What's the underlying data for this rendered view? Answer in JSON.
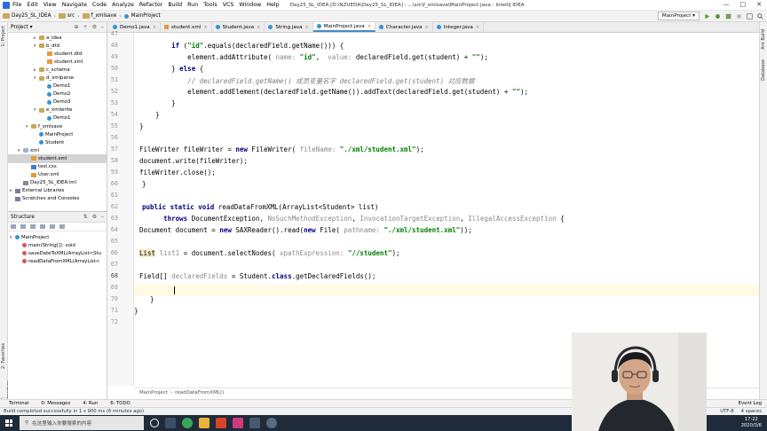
{
  "titlebar": {
    "menu": [
      "File",
      "Edit",
      "View",
      "Navigate",
      "Code",
      "Analyze",
      "Refactor",
      "Build",
      "Run",
      "Tools",
      "VCS",
      "Window",
      "Help"
    ],
    "title": "Day25_SL_IDEA [D:\\NZUEDA\\Day25_SL_IDEA] - ...\\src\\f_xmlsave\\MainProject.java - IntelliJ IDEA"
  },
  "navbar": {
    "crumbs": [
      "Day25_SL_IDEA",
      "src",
      "f_xmlsave",
      "MainProject"
    ],
    "run_config": "MainProject"
  },
  "project_panel": {
    "header": "Project",
    "tree": [
      {
        "label": "a_idea",
        "indent": 3,
        "icon": "dir",
        "arrow": "▸"
      },
      {
        "label": "b_dtd",
        "indent": 3,
        "icon": "dir",
        "arrow": "▾"
      },
      {
        "label": "student.dtd",
        "indent": 4,
        "icon": "xml",
        "arrow": ""
      },
      {
        "label": "student.xml",
        "indent": 4,
        "icon": "xml",
        "arrow": ""
      },
      {
        "label": "c_schema",
        "indent": 3,
        "icon": "dir",
        "arrow": "▸"
      },
      {
        "label": "d_xmlparse",
        "indent": 3,
        "icon": "dir",
        "arrow": "▾"
      },
      {
        "label": "Demo1",
        "indent": 4,
        "icon": "class",
        "arrow": ""
      },
      {
        "label": "Demo2",
        "indent": 4,
        "icon": "class",
        "arrow": ""
      },
      {
        "label": "Demo3",
        "indent": 4,
        "icon": "class",
        "arrow": ""
      },
      {
        "label": "e_xmlwrite",
        "indent": 3,
        "icon": "dir",
        "arrow": "▾"
      },
      {
        "label": "Demo1",
        "indent": 4,
        "icon": "class",
        "arrow": ""
      },
      {
        "label": "f_xmlsave",
        "indent": 2,
        "icon": "dir",
        "arrow": "▾"
      },
      {
        "label": "MainProject",
        "indent": 3,
        "icon": "class",
        "arrow": ""
      },
      {
        "label": "Student",
        "indent": 3,
        "icon": "class",
        "arrow": ""
      },
      {
        "label": "xml",
        "indent": 1,
        "icon": "folder",
        "arrow": "▾"
      },
      {
        "label": "student.xml",
        "indent": 2,
        "icon": "xml",
        "arrow": "",
        "selected": true
      },
      {
        "label": "test.css",
        "indent": 2,
        "icon": "css",
        "arrow": ""
      },
      {
        "label": "User.xml",
        "indent": 2,
        "icon": "xml",
        "arrow": ""
      },
      {
        "label": "Day25_SL_IDEA.iml",
        "indent": 1,
        "icon": "iml",
        "arrow": ""
      },
      {
        "label": "External Libraries",
        "indent": 0,
        "icon": "lib",
        "arrow": "▸"
      },
      {
        "label": "Scratches and Consoles",
        "indent": 0,
        "icon": "lib",
        "arrow": ""
      }
    ]
  },
  "structure_panel": {
    "header": "Structure",
    "items": [
      {
        "label": "MainProject",
        "indent": 0,
        "arrow": "▾"
      },
      {
        "label": "main(String[]): void",
        "indent": 1,
        "arrow": ""
      },
      {
        "label": "saveDateToXML(ArrayList<Stu",
        "indent": 1,
        "arrow": ""
      },
      {
        "label": "readDataFromXML(ArrayList<",
        "indent": 1,
        "arrow": ""
      }
    ]
  },
  "tabs": [
    {
      "label": "Demo1.java",
      "icon": "class",
      "active": false
    },
    {
      "label": "student.xml",
      "icon": "xml",
      "active": false
    },
    {
      "label": "Student.java",
      "icon": "class",
      "active": false
    },
    {
      "label": "String.java",
      "icon": "class",
      "active": false
    },
    {
      "label": "MainProject.java",
      "icon": "class",
      "active": true
    },
    {
      "label": "Character.java",
      "icon": "class",
      "active": false
    },
    {
      "label": "Integer.java",
      "icon": "class",
      "active": false
    }
  ],
  "editor": {
    "line_numbers": [
      "47",
      "48",
      "49",
      "50",
      "51",
      "52",
      "53",
      "54",
      "55",
      "56",
      "57",
      "58",
      "59",
      "60",
      "61",
      "62",
      "63",
      "64",
      "65",
      "66",
      "67",
      "68",
      "69",
      "70",
      "71",
      "72"
    ],
    "current_line": "68",
    "breadcrumb": [
      "MainProject",
      "readDataFromXML()"
    ]
  },
  "bottom_toolbar": {
    "items": [
      "Terminal",
      "0: Messages",
      "4: Run",
      "6: TODO"
    ],
    "right": "Event Log"
  },
  "statusbar": {
    "message": "Build completed successfully in 1 s 900 ms (6 minutes ago)",
    "right": [
      "UTF-8",
      "4 spaces"
    ]
  },
  "taskbar": {
    "search_placeholder": "在这里输入你要搜索的内容",
    "time": "17:22",
    "date": "2020/3/6"
  }
}
